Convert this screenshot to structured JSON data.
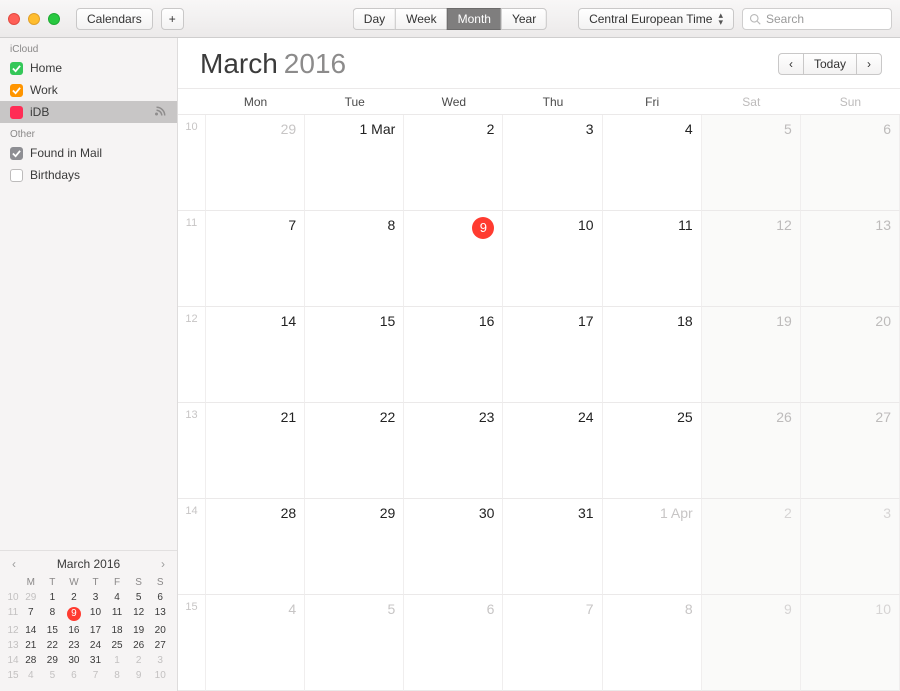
{
  "toolbar": {
    "calendars_btn": "Calendars",
    "views": [
      "Day",
      "Week",
      "Month",
      "Year"
    ],
    "active_view": 2,
    "timezone": "Central European Time",
    "search_placeholder": "Search"
  },
  "sidebar": {
    "groups": [
      {
        "name": "iCloud",
        "items": [
          {
            "label": "Home",
            "color": "#34c759",
            "checked": true
          },
          {
            "label": "Work",
            "color": "#ff9500",
            "checked": true
          },
          {
            "label": "iDB",
            "color": "#ff2d55",
            "checked": false,
            "selected": true,
            "shared": true
          }
        ]
      },
      {
        "name": "Other",
        "items": [
          {
            "label": "Found in Mail",
            "color": "#8e8e93",
            "checked": true
          },
          {
            "label": "Birthdays",
            "color": "#c8c6c6",
            "checked": false
          }
        ]
      }
    ]
  },
  "mini": {
    "title": "March 2016",
    "dow": [
      "M",
      "T",
      "W",
      "T",
      "F",
      "S",
      "S"
    ],
    "today": 9,
    "rows": [
      {
        "wk": 10,
        "days": [
          {
            "n": 29,
            "dim": true
          },
          {
            "n": 1
          },
          {
            "n": 2
          },
          {
            "n": 3
          },
          {
            "n": 4
          },
          {
            "n": 5
          },
          {
            "n": 6
          }
        ]
      },
      {
        "wk": 11,
        "days": [
          {
            "n": 7
          },
          {
            "n": 8
          },
          {
            "n": 9,
            "today": true
          },
          {
            "n": 10
          },
          {
            "n": 11
          },
          {
            "n": 12
          },
          {
            "n": 13
          }
        ]
      },
      {
        "wk": 12,
        "days": [
          {
            "n": 14
          },
          {
            "n": 15
          },
          {
            "n": 16
          },
          {
            "n": 17
          },
          {
            "n": 18
          },
          {
            "n": 19
          },
          {
            "n": 20
          }
        ]
      },
      {
        "wk": 13,
        "days": [
          {
            "n": 21
          },
          {
            "n": 22
          },
          {
            "n": 23
          },
          {
            "n": 24
          },
          {
            "n": 25
          },
          {
            "n": 26
          },
          {
            "n": 27
          }
        ]
      },
      {
        "wk": 14,
        "days": [
          {
            "n": 28
          },
          {
            "n": 29
          },
          {
            "n": 30
          },
          {
            "n": 31
          },
          {
            "n": 1,
            "dim": true
          },
          {
            "n": 2,
            "dim": true
          },
          {
            "n": 3,
            "dim": true
          }
        ]
      },
      {
        "wk": 15,
        "days": [
          {
            "n": 4,
            "dim": true
          },
          {
            "n": 5,
            "dim": true
          },
          {
            "n": 6,
            "dim": true
          },
          {
            "n": 7,
            "dim": true
          },
          {
            "n": 8,
            "dim": true
          },
          {
            "n": 9,
            "dim": true
          },
          {
            "n": 10,
            "dim": true
          }
        ]
      }
    ]
  },
  "main": {
    "month": "March",
    "year": "2016",
    "today_btn": "Today",
    "dow": [
      "Mon",
      "Tue",
      "Wed",
      "Thu",
      "Fri",
      "Sat",
      "Sun"
    ],
    "today_label": "9",
    "weeks": [
      {
        "wk": 10,
        "cells": [
          {
            "t": "29",
            "dim": true
          },
          {
            "t": "1 Mar"
          },
          {
            "t": "2"
          },
          {
            "t": "3"
          },
          {
            "t": "4"
          },
          {
            "t": "5",
            "wknd": true
          },
          {
            "t": "6",
            "wknd": true
          }
        ]
      },
      {
        "wk": 11,
        "cells": [
          {
            "t": "7"
          },
          {
            "t": "8"
          },
          {
            "t": "9",
            "today": true
          },
          {
            "t": "10"
          },
          {
            "t": "11"
          },
          {
            "t": "12",
            "wknd": true
          },
          {
            "t": "13",
            "wknd": true
          }
        ]
      },
      {
        "wk": 12,
        "cells": [
          {
            "t": "14"
          },
          {
            "t": "15"
          },
          {
            "t": "16"
          },
          {
            "t": "17"
          },
          {
            "t": "18"
          },
          {
            "t": "19",
            "wknd": true
          },
          {
            "t": "20",
            "wknd": true
          }
        ]
      },
      {
        "wk": 13,
        "cells": [
          {
            "t": "21"
          },
          {
            "t": "22"
          },
          {
            "t": "23"
          },
          {
            "t": "24"
          },
          {
            "t": "25"
          },
          {
            "t": "26",
            "wknd": true
          },
          {
            "t": "27",
            "wknd": true
          }
        ]
      },
      {
        "wk": 14,
        "cells": [
          {
            "t": "28"
          },
          {
            "t": "29"
          },
          {
            "t": "30"
          },
          {
            "t": "31"
          },
          {
            "t": "1 Apr",
            "dim": true
          },
          {
            "t": "2",
            "wknd": true,
            "dim": true
          },
          {
            "t": "3",
            "wknd": true,
            "dim": true
          }
        ]
      },
      {
        "wk": 15,
        "cells": [
          {
            "t": "4",
            "dim": true
          },
          {
            "t": "5",
            "dim": true
          },
          {
            "t": "6",
            "dim": true
          },
          {
            "t": "7",
            "dim": true
          },
          {
            "t": "8",
            "dim": true
          },
          {
            "t": "9",
            "wknd": true,
            "dim": true
          },
          {
            "t": "10",
            "wknd": true,
            "dim": true
          }
        ]
      }
    ]
  }
}
